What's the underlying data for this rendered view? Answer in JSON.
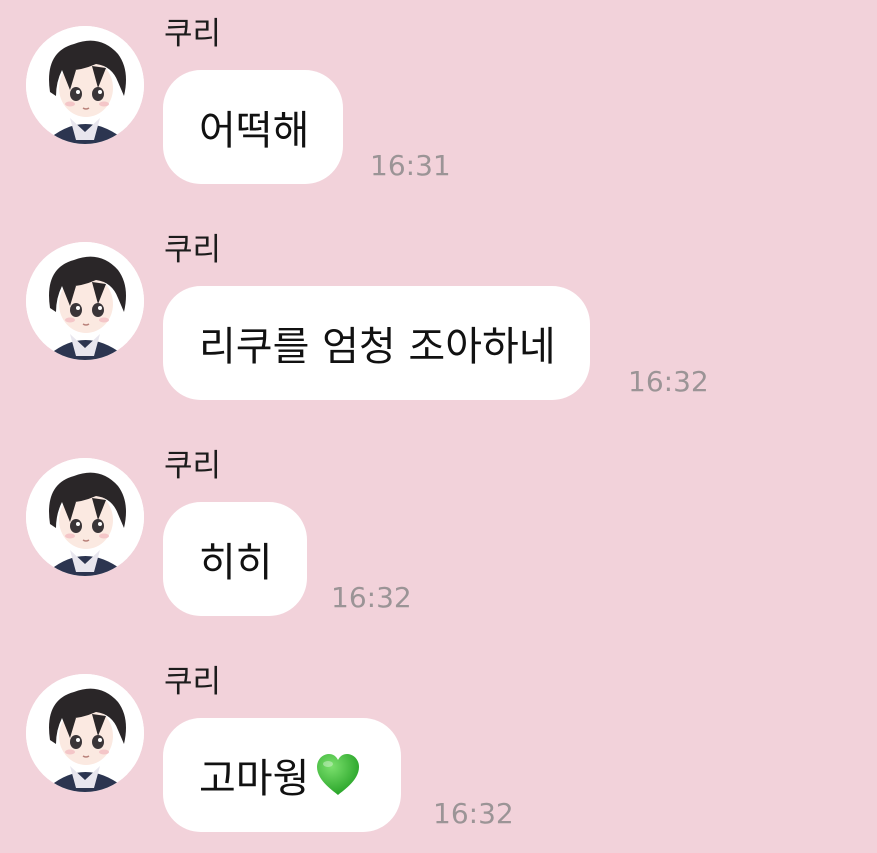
{
  "colors": {
    "background": "#f2d2da",
    "bubble": "#ffffff",
    "timestamp": "#9b9496",
    "heart": "#3fbf3a"
  },
  "messages": [
    {
      "sender": "쿠리",
      "text": "어떡해",
      "time": "16:31"
    },
    {
      "sender": "쿠리",
      "text": "리쿠를 엄청 조아하네",
      "time": "16:32"
    },
    {
      "sender": "쿠리",
      "text": "히히",
      "time": "16:32"
    },
    {
      "sender": "쿠리",
      "text": "고마웡",
      "emoji": "green-heart",
      "time": "16:32"
    }
  ]
}
